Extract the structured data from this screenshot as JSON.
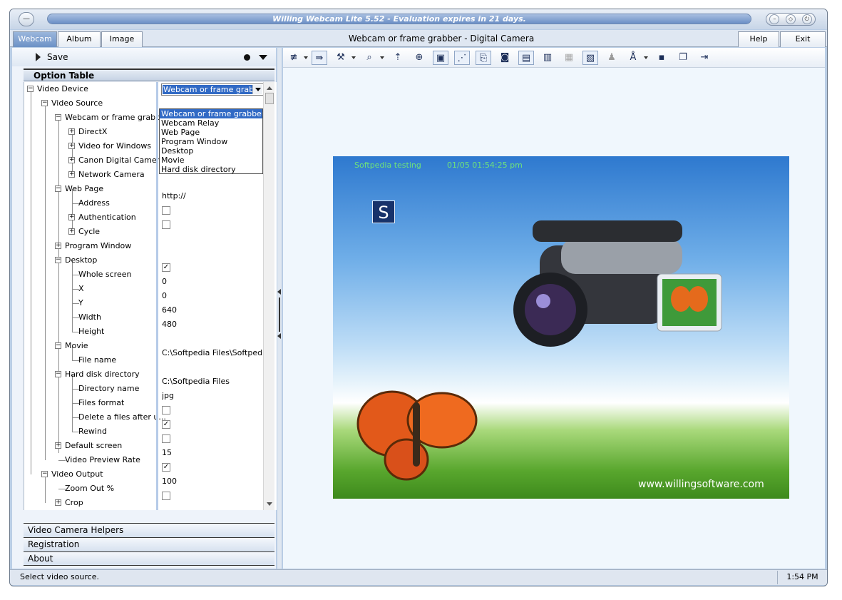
{
  "window": {
    "title": "Willing Webcam Lite 5.52 - Evaluation expires in 21 days.",
    "minimize_glyph": "–",
    "maximize_glyph": "◇",
    "close_glyph": "⏻",
    "app_glyph": "—"
  },
  "tabs": [
    {
      "label": "Webcam"
    },
    {
      "label": "Album"
    },
    {
      "label": "Image"
    }
  ],
  "main_title": "Webcam or frame grabber - Digital Camera",
  "header_buttons": {
    "help": "Help",
    "exit": "Exit"
  },
  "left": {
    "save_label": "Save",
    "option_table_title": "Option Table",
    "tree": [
      {
        "label": "Video Device",
        "expander": "−"
      },
      {
        "label": "Video Source",
        "expander": "−"
      },
      {
        "label": "Webcam or frame grabber",
        "expander": "−"
      },
      {
        "label": "DirectX",
        "expander": "+"
      },
      {
        "label": "Video for Windows",
        "expander": "+"
      },
      {
        "label": "Canon Digital Camera",
        "expander": "+"
      },
      {
        "label": "Network Camera",
        "expander": "+"
      },
      {
        "label": "Web Page",
        "expander": "−"
      },
      {
        "label": "Address"
      },
      {
        "label": "Authentication",
        "expander": "+"
      },
      {
        "label": "Cycle",
        "expander": "+"
      },
      {
        "label": "Program Window",
        "expander": "+"
      },
      {
        "label": "Desktop",
        "expander": "−"
      },
      {
        "label": "Whole screen"
      },
      {
        "label": "X"
      },
      {
        "label": "Y"
      },
      {
        "label": "Width"
      },
      {
        "label": "Height"
      },
      {
        "label": "Movie",
        "expander": "−"
      },
      {
        "label": "File name"
      },
      {
        "label": "Hard disk directory",
        "expander": "−"
      },
      {
        "label": "Directory name"
      },
      {
        "label": "Files format"
      },
      {
        "label": "Delete a files after u..."
      },
      {
        "label": "Rewind"
      },
      {
        "label": "Default screen",
        "expander": "+"
      },
      {
        "label": "Video Preview Rate"
      },
      {
        "label": "Video Output",
        "expander": "−"
      },
      {
        "label": "Zoom Out %"
      },
      {
        "label": "Crop",
        "expander": "+"
      }
    ],
    "values": {
      "video_source": "Webcam or frame grabber",
      "address": "http://",
      "x": "0",
      "y": "0",
      "width": "640",
      "height": "480",
      "file_name": "C:\\Softpedia Files\\Softpedia",
      "directory_name": "C:\\Softpedia Files",
      "files_format": "jpg",
      "preview_rate": "15",
      "zoom_out": "100",
      "check_mark": "✓"
    },
    "dropdown_options": [
      "Webcam or frame grabber",
      "Webcam Relay",
      "Web Page",
      "Program Window",
      "Desktop",
      "Movie",
      "Hard disk directory"
    ],
    "accordion": [
      {
        "label": "Video Camera Helpers"
      },
      {
        "label": "Registration"
      },
      {
        "label": "About"
      }
    ]
  },
  "toolbar_icons": [
    {
      "name": "edit-list-icon",
      "glyph": "≢"
    },
    {
      "name": "align-arrow-icon",
      "glyph": "⇛"
    },
    {
      "name": "tools-icon",
      "glyph": "⚒"
    },
    {
      "name": "zoom-page-icon",
      "glyph": "⌕"
    },
    {
      "name": "page-up-icon",
      "glyph": "⇡"
    },
    {
      "name": "move-target-icon",
      "glyph": "⊕"
    },
    {
      "name": "picture-window-icon",
      "glyph": "▣"
    },
    {
      "name": "magic-wand-icon",
      "glyph": "⋰"
    },
    {
      "name": "paste-note-icon",
      "glyph": "⎘"
    },
    {
      "name": "camera-icon",
      "glyph": "◙"
    },
    {
      "name": "monitor-network-icon",
      "glyph": "▤"
    },
    {
      "name": "panel-icon",
      "glyph": "▥"
    },
    {
      "name": "grid-disabled-icon",
      "glyph": "▦"
    },
    {
      "name": "film-frame-icon",
      "glyph": "▧"
    },
    {
      "name": "alarm-bell-icon",
      "glyph": "♟"
    },
    {
      "name": "text-style-icon",
      "glyph": "Å"
    },
    {
      "name": "save-disk-icon",
      "glyph": "▪"
    },
    {
      "name": "copy-icon",
      "glyph": "❐"
    },
    {
      "name": "exit-door-icon",
      "glyph": "⇥"
    }
  ],
  "preview": {
    "overlay_text": "Softpedia testing",
    "overlay_datetime": "01/05 01:54:25 pm",
    "logo_letter": "S",
    "url": "www.willingsoftware.com"
  },
  "status": {
    "message": "Select video source.",
    "time": "1:54 PM"
  },
  "colors": {
    "accent": "#316ac5",
    "frame": "#b9cde5",
    "overlay_text": "#6fe37a"
  }
}
